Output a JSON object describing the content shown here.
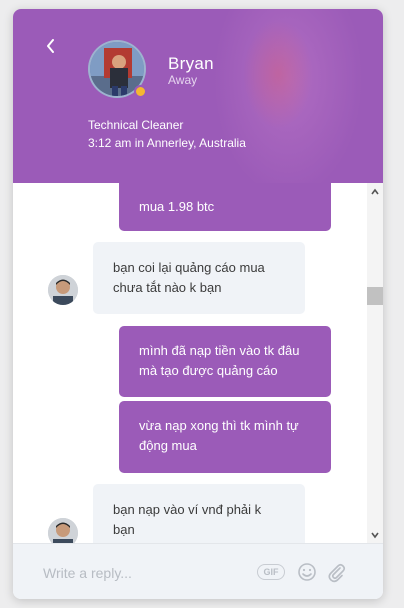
{
  "header": {
    "agent_name": "Bryan",
    "agent_status": "Away",
    "agent_role": "Technical Cleaner",
    "agent_local_time": "3:12 am in Annerley, Australia"
  },
  "messages": [
    {
      "from": "user",
      "text": "mua 1.98 btc"
    },
    {
      "from": "agent",
      "text": "bạn coi lại quảng cáo mua chưa tắt nào k bạn"
    },
    {
      "from": "user",
      "text": "mình đã nạp tiền vào tk đâu mà tạo được quảng cáo"
    },
    {
      "from": "user",
      "text": "vừa nạp xong thì tk mình tự động mua"
    },
    {
      "from": "agent",
      "text": "bạn nạp vào ví vnđ phải k bạn"
    }
  ],
  "composer": {
    "placeholder": "Write a reply...",
    "gif_label": "GIF"
  },
  "icons": [
    "back-arrow-icon",
    "emoji-icon",
    "paperclip-icon",
    "scroll-up-icon",
    "scroll-down-icon"
  ],
  "colors": {
    "accent": "#9b5bb8",
    "incoming_bubble": "#f0f3f7",
    "status_away": "#f5b731"
  }
}
